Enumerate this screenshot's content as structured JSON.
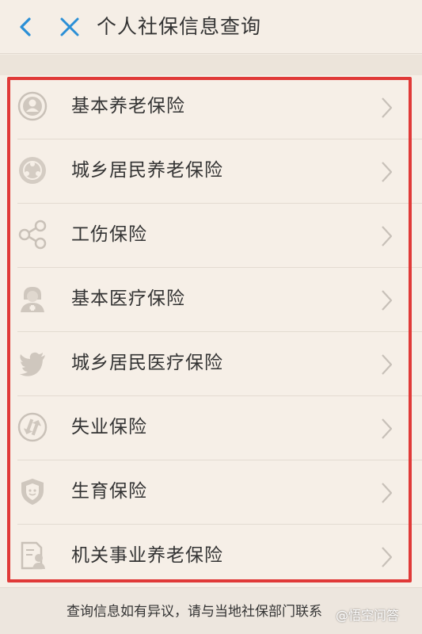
{
  "header": {
    "title": "个人社保信息查询",
    "accent_color": "#2a8fd6"
  },
  "insurance_list": {
    "items": [
      {
        "label": "基本养老保险",
        "icon": "person-circle-icon"
      },
      {
        "label": "城乡居民养老保险",
        "icon": "dots-circle-icon"
      },
      {
        "label": "工伤保险",
        "icon": "share-icon"
      },
      {
        "label": "基本医疗保险",
        "icon": "nurse-icon"
      },
      {
        "label": "城乡居民医疗保险",
        "icon": "bird-icon"
      },
      {
        "label": "失业保险",
        "icon": "exchange-icon"
      },
      {
        "label": "生育保险",
        "icon": "shield-icon"
      },
      {
        "label": "机关事业养老保险",
        "icon": "document-person-icon"
      }
    ],
    "highlight_color": "#e03a38"
  },
  "footer": {
    "notice": "查询信息如有异议，请与当地社保部门联系"
  },
  "watermark": {
    "text": "@悟空问答"
  }
}
